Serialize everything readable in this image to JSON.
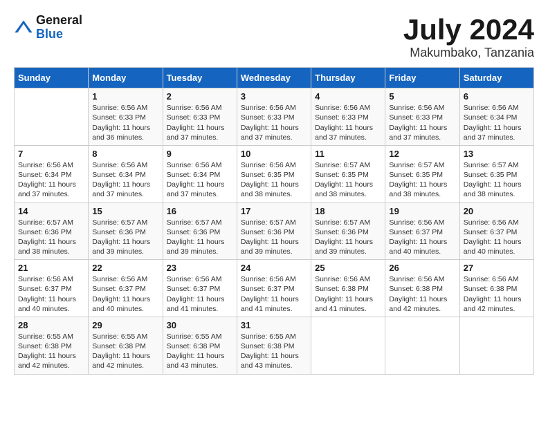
{
  "logo": {
    "general": "General",
    "blue": "Blue"
  },
  "title": {
    "month_year": "July 2024",
    "location": "Makumbako, Tanzania"
  },
  "days_of_week": [
    "Sunday",
    "Monday",
    "Tuesday",
    "Wednesday",
    "Thursday",
    "Friday",
    "Saturday"
  ],
  "weeks": [
    [
      {
        "day": "",
        "info": ""
      },
      {
        "day": "1",
        "info": "Sunrise: 6:56 AM\nSunset: 6:33 PM\nDaylight: 11 hours\nand 36 minutes."
      },
      {
        "day": "2",
        "info": "Sunrise: 6:56 AM\nSunset: 6:33 PM\nDaylight: 11 hours\nand 37 minutes."
      },
      {
        "day": "3",
        "info": "Sunrise: 6:56 AM\nSunset: 6:33 PM\nDaylight: 11 hours\nand 37 minutes."
      },
      {
        "day": "4",
        "info": "Sunrise: 6:56 AM\nSunset: 6:33 PM\nDaylight: 11 hours\nand 37 minutes."
      },
      {
        "day": "5",
        "info": "Sunrise: 6:56 AM\nSunset: 6:33 PM\nDaylight: 11 hours\nand 37 minutes."
      },
      {
        "day": "6",
        "info": "Sunrise: 6:56 AM\nSunset: 6:34 PM\nDaylight: 11 hours\nand 37 minutes."
      }
    ],
    [
      {
        "day": "7",
        "info": "Sunrise: 6:56 AM\nSunset: 6:34 PM\nDaylight: 11 hours\nand 37 minutes."
      },
      {
        "day": "8",
        "info": "Sunrise: 6:56 AM\nSunset: 6:34 PM\nDaylight: 11 hours\nand 37 minutes."
      },
      {
        "day": "9",
        "info": "Sunrise: 6:56 AM\nSunset: 6:34 PM\nDaylight: 11 hours\nand 37 minutes."
      },
      {
        "day": "10",
        "info": "Sunrise: 6:56 AM\nSunset: 6:35 PM\nDaylight: 11 hours\nand 38 minutes."
      },
      {
        "day": "11",
        "info": "Sunrise: 6:57 AM\nSunset: 6:35 PM\nDaylight: 11 hours\nand 38 minutes."
      },
      {
        "day": "12",
        "info": "Sunrise: 6:57 AM\nSunset: 6:35 PM\nDaylight: 11 hours\nand 38 minutes."
      },
      {
        "day": "13",
        "info": "Sunrise: 6:57 AM\nSunset: 6:35 PM\nDaylight: 11 hours\nand 38 minutes."
      }
    ],
    [
      {
        "day": "14",
        "info": "Sunrise: 6:57 AM\nSunset: 6:36 PM\nDaylight: 11 hours\nand 38 minutes."
      },
      {
        "day": "15",
        "info": "Sunrise: 6:57 AM\nSunset: 6:36 PM\nDaylight: 11 hours\nand 39 minutes."
      },
      {
        "day": "16",
        "info": "Sunrise: 6:57 AM\nSunset: 6:36 PM\nDaylight: 11 hours\nand 39 minutes."
      },
      {
        "day": "17",
        "info": "Sunrise: 6:57 AM\nSunset: 6:36 PM\nDaylight: 11 hours\nand 39 minutes."
      },
      {
        "day": "18",
        "info": "Sunrise: 6:57 AM\nSunset: 6:36 PM\nDaylight: 11 hours\nand 39 minutes."
      },
      {
        "day": "19",
        "info": "Sunrise: 6:56 AM\nSunset: 6:37 PM\nDaylight: 11 hours\nand 40 minutes."
      },
      {
        "day": "20",
        "info": "Sunrise: 6:56 AM\nSunset: 6:37 PM\nDaylight: 11 hours\nand 40 minutes."
      }
    ],
    [
      {
        "day": "21",
        "info": "Sunrise: 6:56 AM\nSunset: 6:37 PM\nDaylight: 11 hours\nand 40 minutes."
      },
      {
        "day": "22",
        "info": "Sunrise: 6:56 AM\nSunset: 6:37 PM\nDaylight: 11 hours\nand 40 minutes."
      },
      {
        "day": "23",
        "info": "Sunrise: 6:56 AM\nSunset: 6:37 PM\nDaylight: 11 hours\nand 41 minutes."
      },
      {
        "day": "24",
        "info": "Sunrise: 6:56 AM\nSunset: 6:37 PM\nDaylight: 11 hours\nand 41 minutes."
      },
      {
        "day": "25",
        "info": "Sunrise: 6:56 AM\nSunset: 6:38 PM\nDaylight: 11 hours\nand 41 minutes."
      },
      {
        "day": "26",
        "info": "Sunrise: 6:56 AM\nSunset: 6:38 PM\nDaylight: 11 hours\nand 42 minutes."
      },
      {
        "day": "27",
        "info": "Sunrise: 6:56 AM\nSunset: 6:38 PM\nDaylight: 11 hours\nand 42 minutes."
      }
    ],
    [
      {
        "day": "28",
        "info": "Sunrise: 6:55 AM\nSunset: 6:38 PM\nDaylight: 11 hours\nand 42 minutes."
      },
      {
        "day": "29",
        "info": "Sunrise: 6:55 AM\nSunset: 6:38 PM\nDaylight: 11 hours\nand 42 minutes."
      },
      {
        "day": "30",
        "info": "Sunrise: 6:55 AM\nSunset: 6:38 PM\nDaylight: 11 hours\nand 43 minutes."
      },
      {
        "day": "31",
        "info": "Sunrise: 6:55 AM\nSunset: 6:38 PM\nDaylight: 11 hours\nand 43 minutes."
      },
      {
        "day": "",
        "info": ""
      },
      {
        "day": "",
        "info": ""
      },
      {
        "day": "",
        "info": ""
      }
    ]
  ]
}
